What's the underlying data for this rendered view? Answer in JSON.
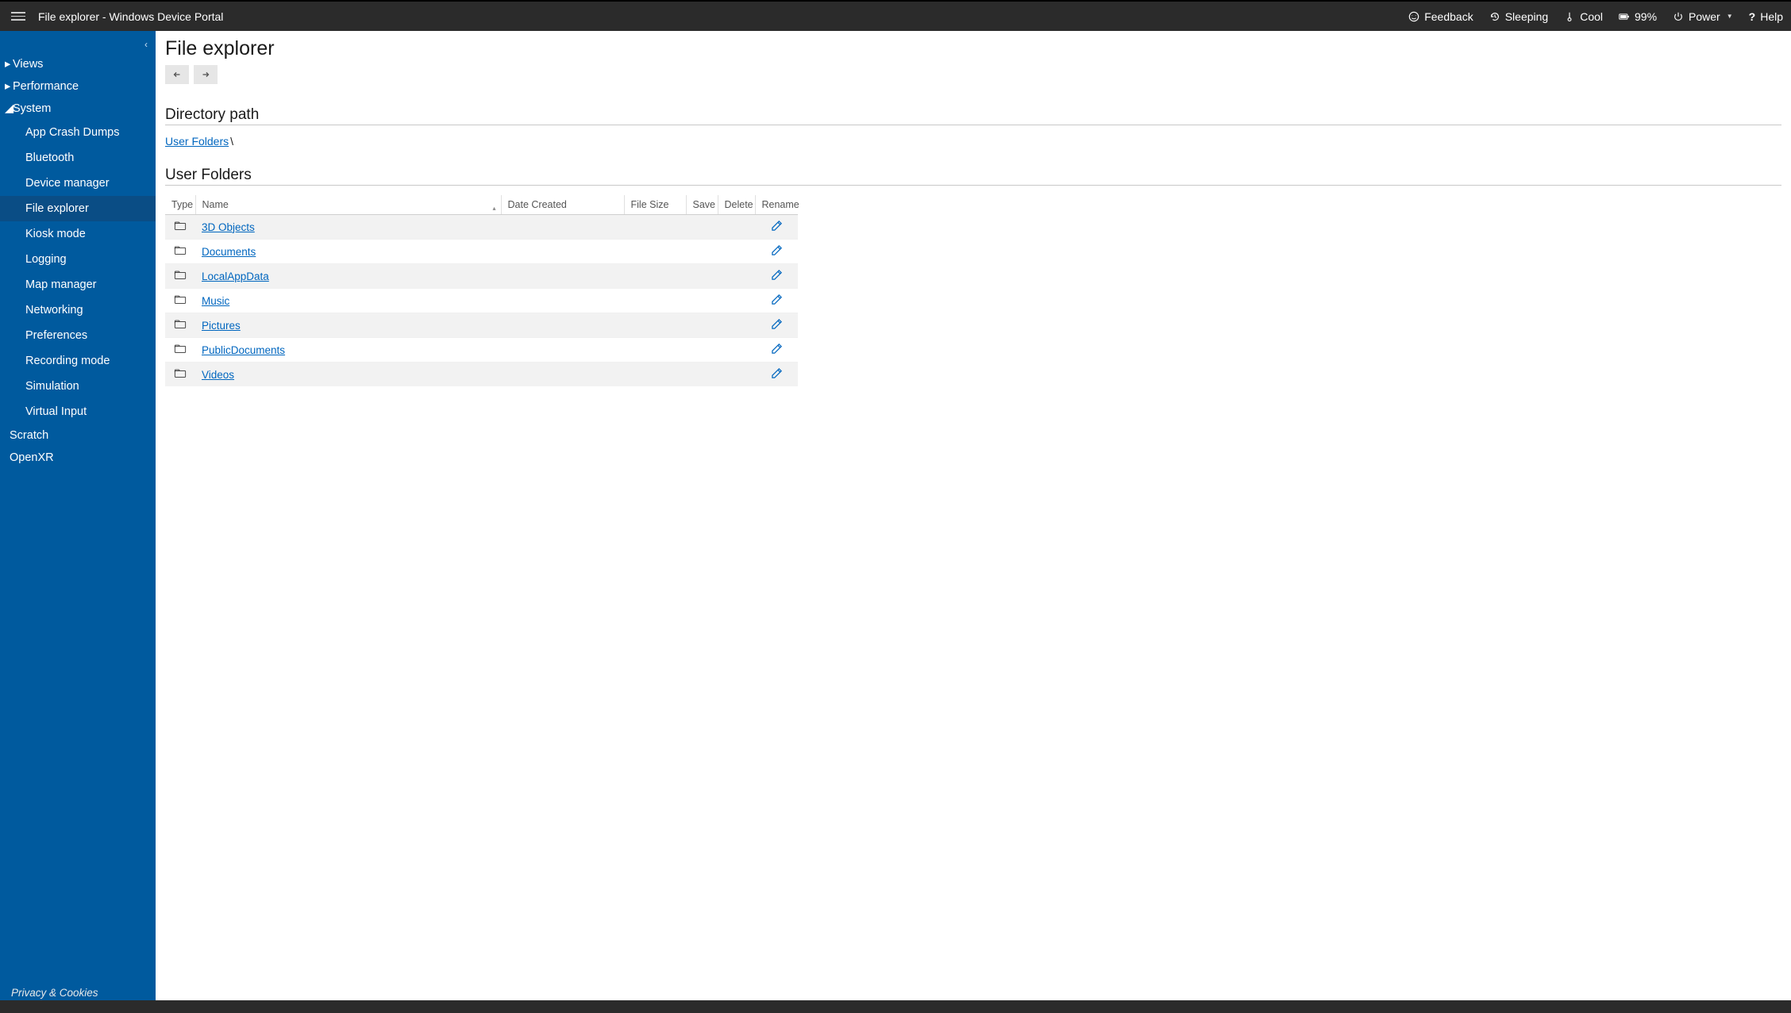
{
  "header": {
    "title": "File explorer - Windows Device Portal",
    "feedback": "Feedback",
    "sleeping": "Sleeping",
    "cool": "Cool",
    "battery": "99%",
    "power": "Power",
    "help": "Help"
  },
  "sidebar": {
    "views": "Views",
    "performance": "Performance",
    "system": "System",
    "system_children": [
      "App Crash Dumps",
      "Bluetooth",
      "Device manager",
      "File explorer",
      "Kiosk mode",
      "Logging",
      "Map manager",
      "Networking",
      "Preferences",
      "Recording mode",
      "Simulation",
      "Virtual Input"
    ],
    "scratch": "Scratch",
    "openxr": "OpenXR",
    "footer": "Privacy & Cookies"
  },
  "main": {
    "page_title": "File explorer",
    "dir_path_heading": "Directory path",
    "breadcrumb_root": "User Folders",
    "breadcrumb_sep": "\\",
    "list_heading": "User Folders",
    "columns": {
      "type": "Type",
      "name": "Name",
      "date": "Date Created",
      "size": "File Size",
      "save": "Save",
      "delete": "Delete",
      "rename": "Rename"
    },
    "rows": [
      {
        "name": "3D Objects"
      },
      {
        "name": "Documents"
      },
      {
        "name": "LocalAppData"
      },
      {
        "name": "Music"
      },
      {
        "name": "Pictures"
      },
      {
        "name": "PublicDocuments"
      },
      {
        "name": "Videos"
      }
    ]
  }
}
